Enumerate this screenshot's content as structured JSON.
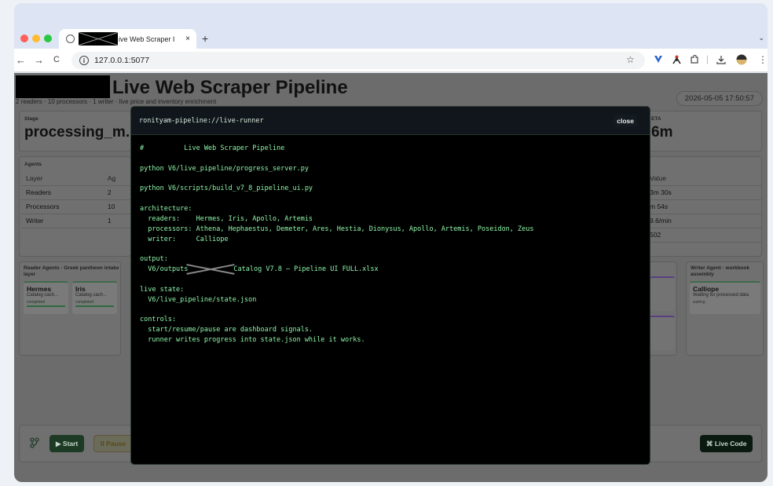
{
  "browser": {
    "tab_title": "ive Web Scraper I",
    "tab_close": "×",
    "new_tab": "+",
    "tab_menu": "⌄",
    "url": "127.0.0.1:5077",
    "nav": {
      "back": "←",
      "forward": "→",
      "reload": "C"
    },
    "toolbar_icons": {
      "bookmark": "☆",
      "menu": "⋮"
    }
  },
  "app": {
    "title": "Live Web Scraper Pipeline",
    "subtitle": "2 readers · 10 processors · 1 writer · live price and inventory enrichment",
    "clock": "2026-05-05 17:50:57",
    "stage": {
      "label": "Stage",
      "value": "processing_m..."
    },
    "eta": {
      "label": "ETA",
      "value": "6m"
    },
    "agents": {
      "label": "Agents",
      "columns": [
        "Layer",
        "Ag"
      ],
      "rows": [
        [
          "Readers",
          "2"
        ],
        [
          "Processors",
          "10"
        ],
        [
          "Writer",
          "1"
        ]
      ]
    },
    "stats": {
      "column": "Value",
      "values": [
        "3m 30s",
        "m 54s",
        "9.6/min",
        "502"
      ]
    },
    "reader_panel": {
      "title": "Reader Agents · Greek pantheon intake layer",
      "agents": [
        {
          "name": "Hermes",
          "sub": "Catalog cach...",
          "status": "completed"
        },
        {
          "name": "Iris",
          "sub": "Catalog cach...",
          "status": "completed"
        }
      ]
    },
    "writer_panel": {
      "title": "Writer Agent · workbook assembly",
      "agent": {
        "name": "Calliope",
        "sub": "Waiting for processed data",
        "status": "waiting"
      }
    },
    "controls": {
      "start": "▶ Start",
      "pause": "II Pause",
      "live_code": "⌘ Live Code"
    }
  },
  "modal": {
    "title": "ronityam-pipeline://live-runner",
    "close": "close",
    "lines": [
      "#          Live Web Scraper Pipeline",
      "",
      "python V6/live_pipeline/progress_server.py",
      "",
      "python V6/scripts/build_v7_8_pipeline_ui.py",
      "",
      "architecture:",
      "  readers:    Hermes, Iris, Apollo, Artemis",
      "  processors: Athena, Hephaestus, Demeter, Ares, Hestia, Dionysus, Apollo, Artemis, Poseidon, Zeus",
      "  writer:     Calliope",
      "",
      "output:"
    ],
    "output_prefix": "  V6/outputs",
    "output_suffix": "Catalog V7.8 — Pipeline UI FULL.xlsx",
    "lines2": [
      "",
      "live state:",
      "  V6/live_pipeline/state.json",
      "",
      "controls:",
      "  start/resume/pause are dashboard signals.",
      "  runner writes progress into state.json while it works."
    ]
  }
}
